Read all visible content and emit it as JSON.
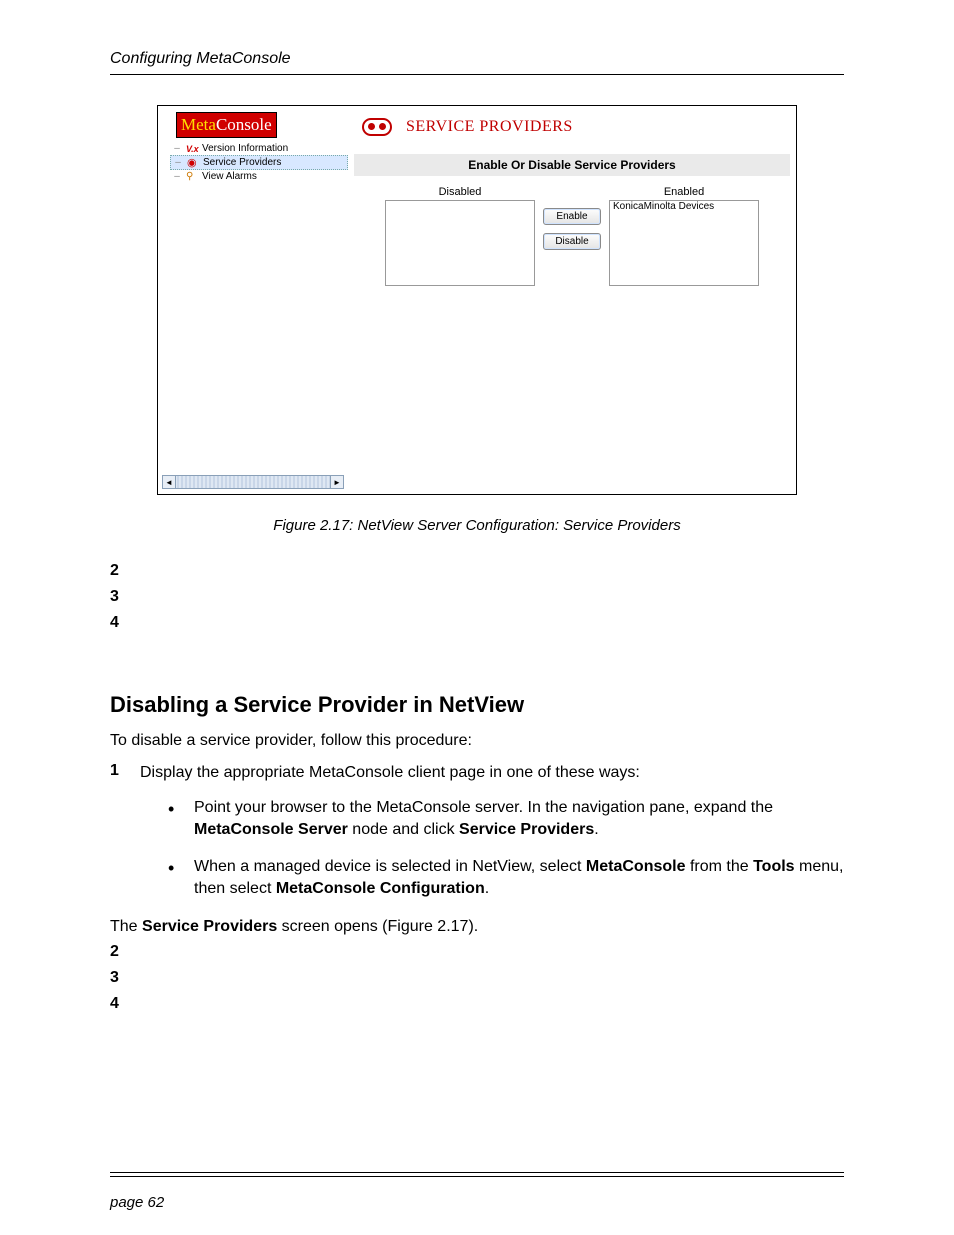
{
  "header": {
    "running_head": "Configuring MetaConsole"
  },
  "figure": {
    "brand": {
      "meta": "Meta",
      "console": "Console"
    },
    "nav": {
      "items": [
        {
          "icon": "vx",
          "label": "Version Information"
        },
        {
          "icon": "eye",
          "label": "Service Providers"
        },
        {
          "icon": "alarm",
          "label": "View Alarms"
        }
      ]
    },
    "panel": {
      "title": "SERVICE PROVIDERS",
      "bar": "Enable Or Disable Service Providers",
      "disabled_label": "Disabled",
      "enabled_label": "Enabled",
      "enable_btn": "Enable",
      "disable_btn": "Disable",
      "enabled_items": [
        "KonicaMinolta Devices"
      ]
    },
    "caption": "Figure 2.17:  NetView Server Configuration: Service Providers"
  },
  "gap_steps_a": [
    "2",
    "3",
    "4"
  ],
  "section": {
    "title": "Disabling a Service Provider in NetView",
    "intro": "To disable a service provider, follow this procedure:",
    "step1_num": "1",
    "step1_text": "Display the appropriate MetaConsole client page in one of these ways:",
    "bullet1_a": "Point your browser to the MetaConsole server. In the navigation pane, expand the ",
    "bullet1_b": "MetaConsole Server",
    "bullet1_c": " node and click ",
    "bullet1_d": "Service Providers",
    "bullet1_e": ".",
    "bullet2_a": "When a managed device is selected in NetView, select ",
    "bullet2_b": "MetaConsole",
    "bullet2_c": " from the ",
    "bullet2_d": "Tools",
    "bullet2_e": " menu, then select ",
    "bullet2_f": "MetaConsole Configuration",
    "bullet2_g": ".",
    "after_a": "The ",
    "after_b": "Service Providers",
    "after_c": " screen opens (Figure 2.17)."
  },
  "gap_steps_b": [
    "2",
    "3",
    "4"
  ],
  "footer": {
    "page": "page 62"
  }
}
